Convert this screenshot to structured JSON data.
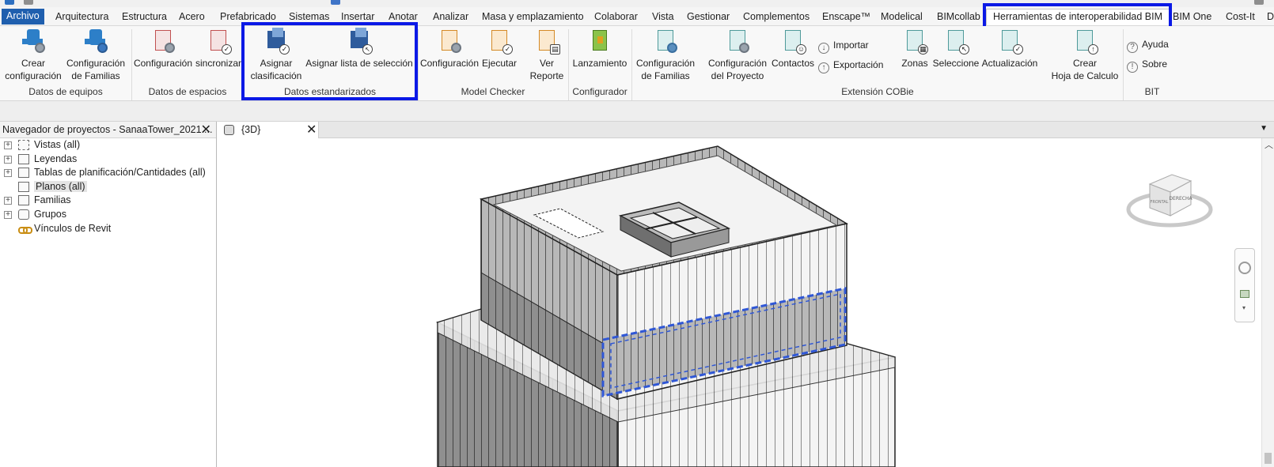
{
  "ribbon_tabs": [
    "Archivo",
    "Arquitectura",
    "Estructura",
    "Acero",
    "Prefabricado",
    "Sistemas",
    "Insertar",
    "Anotar",
    "Analizar",
    "Masa y emplazamiento",
    "Colaborar",
    "Vista",
    "Gestionar",
    "Complementos",
    "Enscape™",
    "Modelical",
    "BIMcollab",
    "Herramientas de interoperabilidad BIM",
    "BIM One",
    "Cost-It",
    "D"
  ],
  "active_tab": "Herramientas de interoperabilidad BIM",
  "ribbon": {
    "crear_configuracion": "Crear\nconfiguración",
    "config_familias_eq": "Configuración\nde Familias",
    "configuracion_esp": "Configuración",
    "sincronizar": "sincronizar",
    "asignar_clasificacion": "Asignar\nclasificación",
    "asignar_lista": "Asignar lista de selección",
    "mc_configuracion": "Configuración",
    "mc_ejecutar": "Ejecutar",
    "mc_ver_reporte": "Ver\nReporte",
    "lanzamiento": "Lanzamiento",
    "cobie_config_familias": "Configuración\nde Familias",
    "cobie_config_proyecto": "Configuración\ndel Proyecto",
    "cobie_contactos": "Contactos",
    "cobie_importar": "Importar",
    "cobie_exportacion": "Exportación",
    "cobie_zonas": "Zonas",
    "cobie_seleccione": "Seleccione",
    "cobie_actualizacion": "Actualización",
    "crear_hoja": "Crear\nHoja de Calculo",
    "ayuda": "Ayuda",
    "sobre": "Sobre"
  },
  "groups": {
    "datos_equipos": "Datos de equipos",
    "datos_espacios": "Datos de espacios",
    "datos_estandarizados": "Datos estandarizados",
    "model_checker": "Model Checker",
    "configurador": "Configurador",
    "extension_cobie": "Extensión COBie",
    "bit": "BIT"
  },
  "browser": {
    "title": "Navegador de proyectos - SanaaTower_2021....",
    "items": [
      {
        "label": "Vistas (all)",
        "expandable": true
      },
      {
        "label": "Leyendas",
        "expandable": true
      },
      {
        "label": "Tablas de planificación/Cantidades (all)",
        "expandable": true
      },
      {
        "label": "Planos (all)",
        "expandable": false
      },
      {
        "label": "Familias",
        "expandable": true
      },
      {
        "label": "Grupos",
        "expandable": true
      },
      {
        "label": "Vínculos de Revit",
        "expandable": false
      }
    ]
  },
  "view_tab": {
    "label": "{3D}"
  },
  "viewcube": {
    "front": "DERECHA",
    "left": "FRONTAL"
  },
  "colors": {
    "file_tab": "#1f5fae",
    "highlight": "#0b19e6",
    "selection": "#2f57d6"
  }
}
